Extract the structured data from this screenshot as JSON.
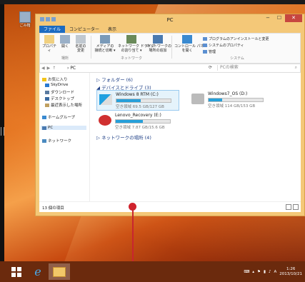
{
  "window": {
    "title": "PC"
  },
  "ribbon": {
    "tabs": [
      "ファイル",
      "コンピューター",
      "表示"
    ],
    "groups": [
      {
        "label": "場所",
        "items": [
          "プロパティ",
          "開く",
          "名前の\n変更"
        ]
      },
      {
        "label": "ネットワーク",
        "items": [
          "メディアの\n接続と切断 ▾",
          "ネットワーク ドライブ\nの割り当て ▾",
          "ネットワークの\n場所の追加"
        ]
      },
      {
        "label": "システム",
        "items": [
          "コントロール パネル\nを開く"
        ]
      }
    ],
    "system_links": [
      "プログラムのアンインストールと変更",
      "システムのプロパティ",
      "管理"
    ]
  },
  "address": {
    "breadcrumb": "PC",
    "search_placeholder": "PCの検索"
  },
  "nav": {
    "items": [
      "お気に入り",
      "SkyDrive",
      "ダウンロード",
      "デスクトップ",
      "最近表示した場所",
      "ホームグループ",
      "PC",
      "ネットワーク"
    ]
  },
  "sections": {
    "folders": "フォルダー (6)",
    "devices": "デバイスとドライブ (3)",
    "network": "ネットワークの場所 (4)"
  },
  "drives": [
    {
      "name": "Windows 8 RTM (C:)",
      "free": "空き領域 69.5 GB/127 GB",
      "used_fraction": 0.45,
      "color": "#26a0da"
    },
    {
      "name": "Windows7_OS (D:)",
      "free": "空き領域 114 GB/153 GB",
      "used_fraction": 0.25,
      "color": "#26a0da"
    },
    {
      "name": "Lenovo_Recovery (E:)",
      "free": "空き領域 7.87 GB/15.6 GB",
      "used_fraction": 0.5,
      "color": "#26a0da"
    }
  ],
  "status": {
    "items_count": "13 個の項目"
  },
  "desktop_icon": {
    "label": "ごみ箱"
  },
  "clock": {
    "time": "1:26",
    "date": "2013/10/21"
  }
}
